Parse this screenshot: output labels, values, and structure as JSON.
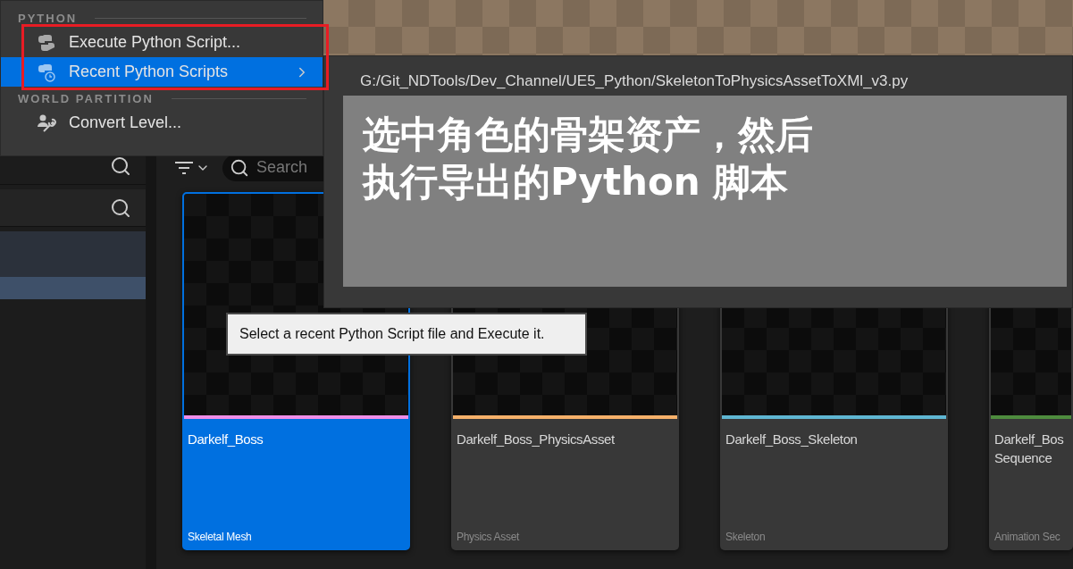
{
  "menu": {
    "sections": [
      {
        "heading": "PYTHON",
        "items": [
          {
            "kind": "python",
            "label": "Execute Python Script...",
            "selected": false,
            "has_submenu": false
          },
          {
            "kind": "python-recent",
            "label": "Recent Python Scripts",
            "selected": true,
            "has_submenu": true
          }
        ]
      },
      {
        "heading": "WORLD PARTITION",
        "items": [
          {
            "kind": "convert",
            "label": "Convert Level...",
            "selected": false,
            "has_submenu": false
          }
        ]
      }
    ]
  },
  "submenu": {
    "items": [
      {
        "label": "G:/Git_NDTools/Dev_Channel/UE5_Python/SkeletonToPhysicsAssetToXMl_v3.py"
      }
    ]
  },
  "note": {
    "lines": [
      "选中角色的骨架资产，然后",
      "执行导出的Python 脚本"
    ]
  },
  "tooltip": {
    "text": "Select a recent Python Script file and Execute it."
  },
  "left_panel": {
    "rows": [
      {
        "selected": false
      },
      {
        "selected": true
      }
    ]
  },
  "toolbar": {
    "search": {
      "placeholder": "Search"
    }
  },
  "assets": [
    {
      "name": "Darkelf_Boss",
      "type": "Skeletal Mesh",
      "color": "#f08ee8",
      "selected": true
    },
    {
      "name": "Darkelf_Boss_PhysicsAsset",
      "type": "Physics Asset",
      "color": "#f5b06a",
      "selected": false
    },
    {
      "name": "Darkelf_Boss_Skeleton",
      "type": "Skeleton",
      "color": "#5fb6d2",
      "selected": false
    },
    {
      "name": "Darkelf_Bos Sequence",
      "type": "Animation Sec",
      "color": "#4e8c3e",
      "selected": false
    }
  ]
}
